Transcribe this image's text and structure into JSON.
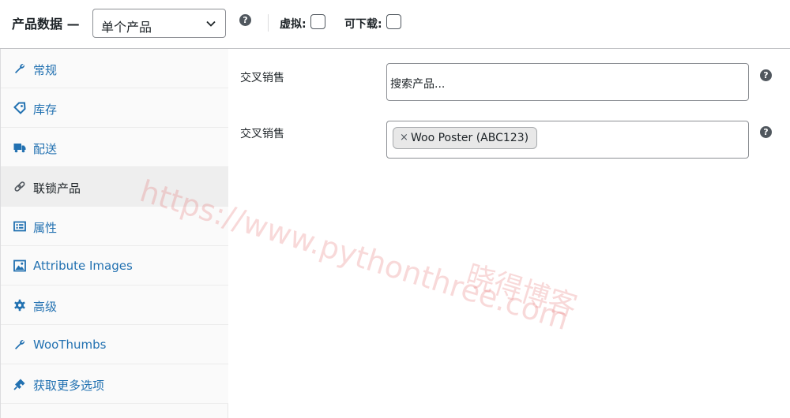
{
  "header": {
    "title": "产品数据 —",
    "product_type": "单个产品",
    "virtual_label": "虚拟:",
    "downloadable_label": "可下载:",
    "help_glyph": "?"
  },
  "sidebar": {
    "items": [
      {
        "label": "常规",
        "icon": "wrench-icon"
      },
      {
        "label": "库存",
        "icon": "tag-icon"
      },
      {
        "label": "配送",
        "icon": "truck-icon"
      },
      {
        "label": "联锁产品",
        "icon": "link-icon",
        "active": true
      },
      {
        "label": "属性",
        "icon": "list-card-icon"
      },
      {
        "label": "Attribute Images",
        "icon": "image-icon"
      },
      {
        "label": "高级",
        "icon": "gear-icon"
      },
      {
        "label": "WooThumbs",
        "icon": "wrench-icon"
      },
      {
        "label": "获取更多选项",
        "icon": "plugin-icon"
      }
    ]
  },
  "main": {
    "upsells": {
      "label": "交叉销售",
      "placeholder": "搜索产品..."
    },
    "cross_sells": {
      "label": "交叉销售",
      "remove_glyph": "×",
      "tag": "Woo Poster (ABC123)"
    }
  },
  "watermark": {
    "url": "https://www.pythonthree.com",
    "name": "晓得博客"
  },
  "colors": {
    "link": "#2271b1",
    "text": "#1d2327",
    "border": "#8c8f94",
    "help": "#50575e",
    "active_bg": "#eeeeee"
  }
}
